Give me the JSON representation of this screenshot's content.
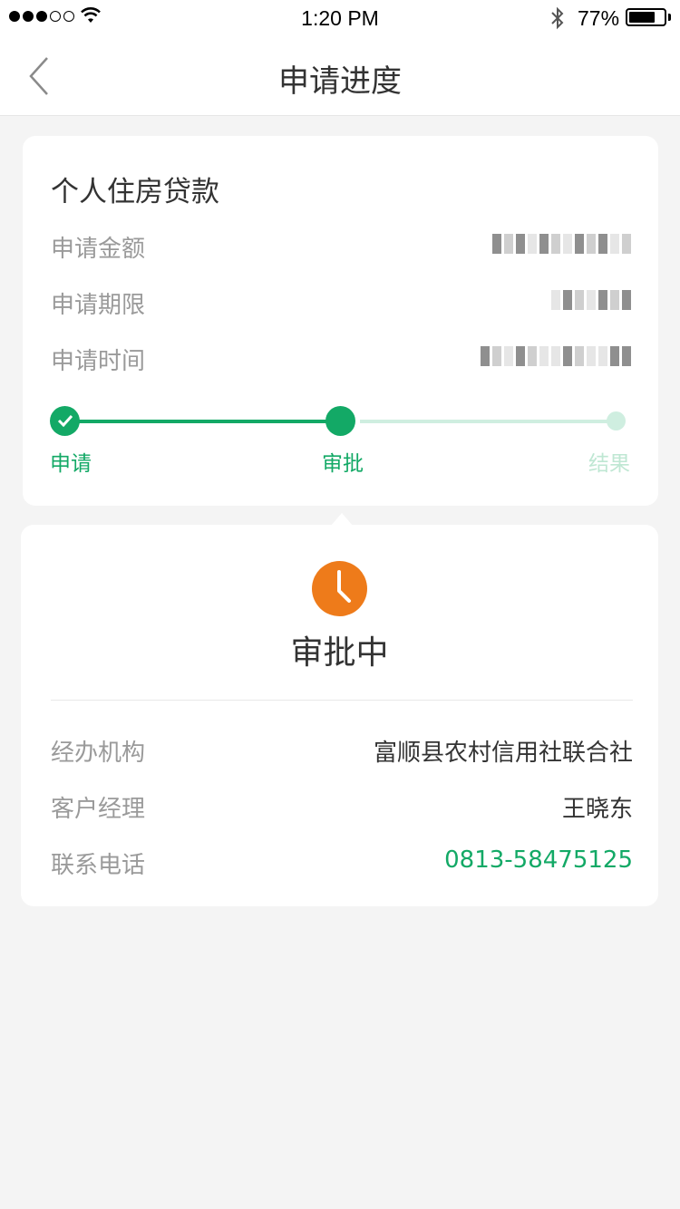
{
  "status_bar": {
    "time": "1:20 PM",
    "battery": "77%",
    "battery_level": 0.77
  },
  "nav": {
    "title": "申请进度",
    "back_icon": "chevron-left-icon"
  },
  "loan": {
    "title": "个人住房贷款",
    "rows": [
      {
        "label": "申请金额"
      },
      {
        "label": "申请期限"
      },
      {
        "label": "申请时间"
      }
    ]
  },
  "progress": {
    "steps": [
      {
        "label": "申请",
        "state": "done"
      },
      {
        "label": "审批",
        "state": "current"
      },
      {
        "label": "结果",
        "state": "pending"
      }
    ]
  },
  "approval": {
    "icon": "clock-icon",
    "status": "审批中",
    "details": [
      {
        "label": "经办机构",
        "value": "富顺县农村信用社联合社"
      },
      {
        "label": "客户经理",
        "value": "王晓东"
      },
      {
        "label": "联系电话",
        "value": "0813-58475125"
      }
    ]
  },
  "colors": {
    "accent": "#13a966",
    "accent_light": "#cfeee0",
    "clock": "#ee7b1a",
    "label": "#9a9a9a",
    "background": "#f4f4f4"
  }
}
